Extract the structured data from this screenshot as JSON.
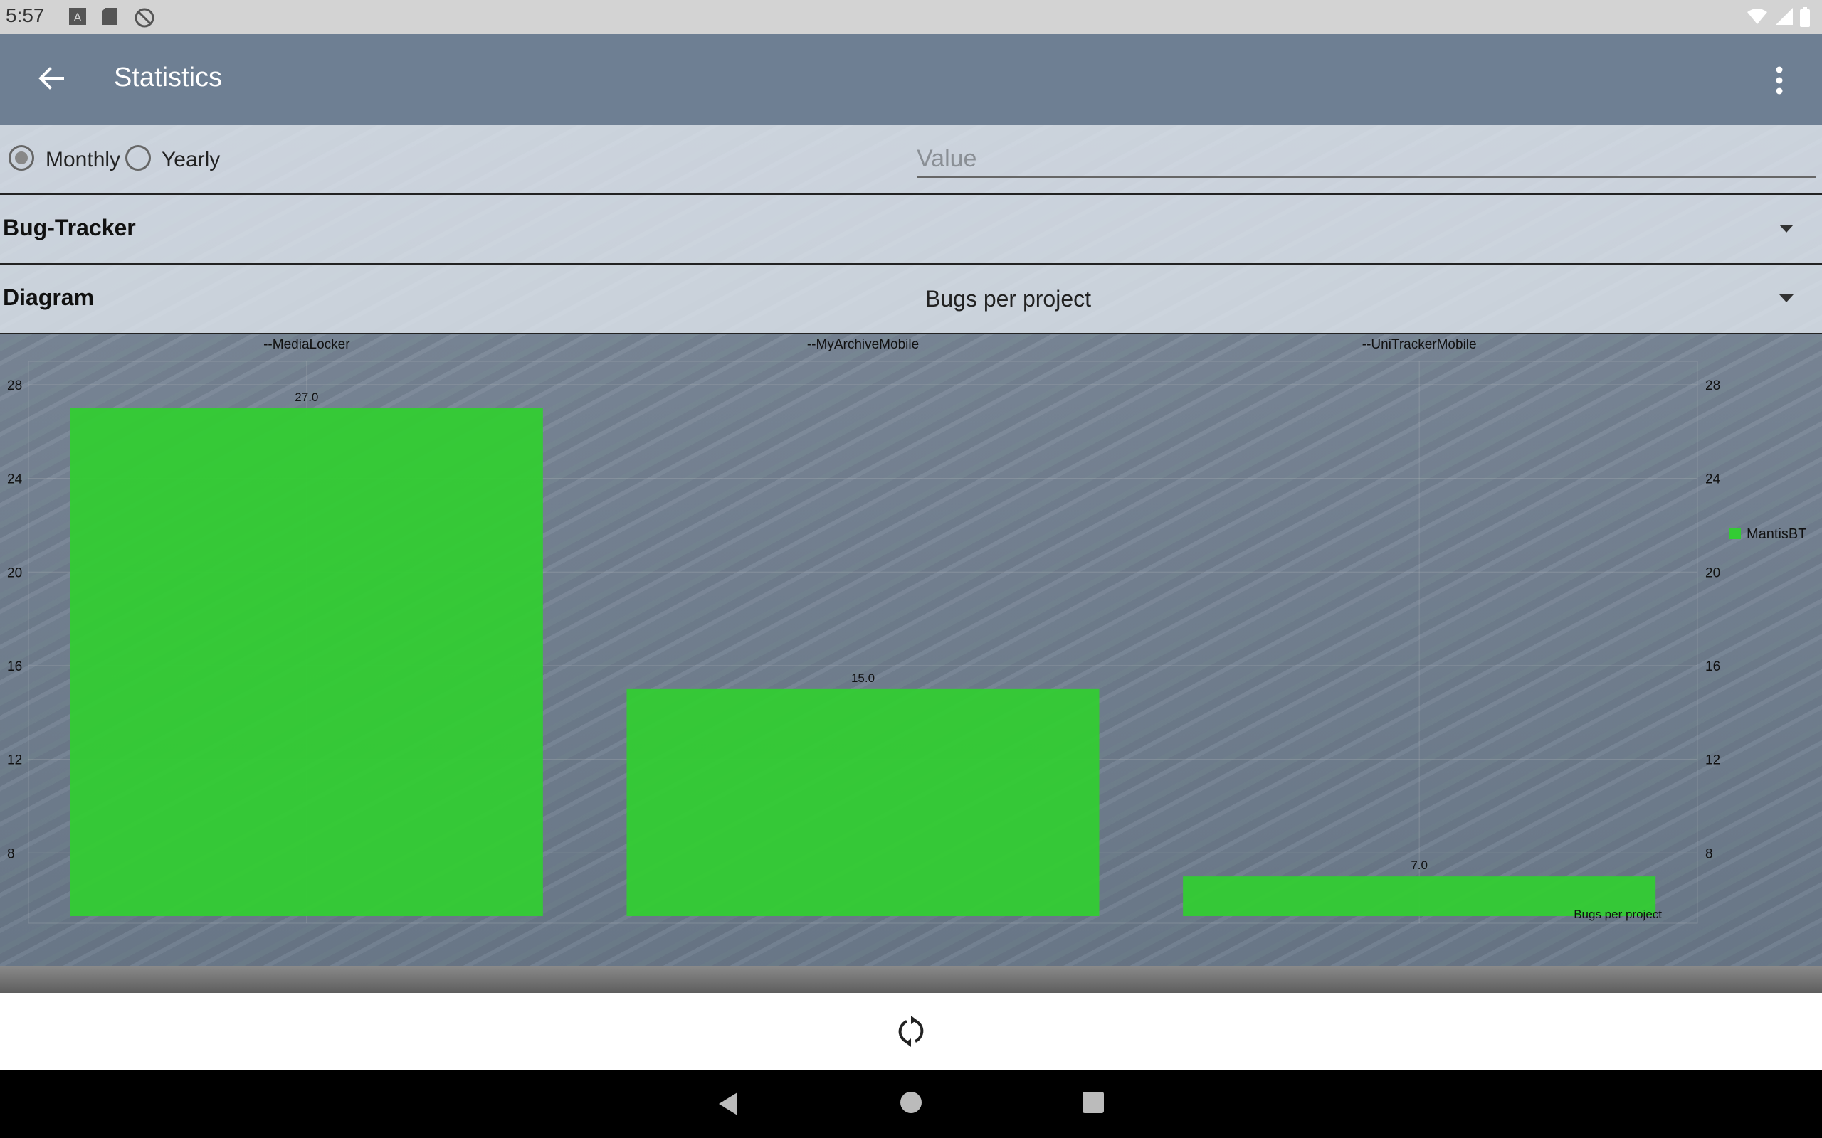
{
  "status_bar": {
    "time": "5:57",
    "icons_left": [
      "a-notification-icon",
      "sd-card-icon",
      "sync-disabled-icon"
    ],
    "icons_right": [
      "wifi-icon",
      "signal-icon",
      "battery-icon"
    ]
  },
  "toolbar": {
    "title": "Statistics",
    "back_icon": "arrow-back-icon",
    "menu_icon": "more-vert-icon"
  },
  "filters": {
    "monthly_label": "Monthly",
    "yearly_label": "Yearly",
    "selected": "Monthly",
    "value_placeholder": "Value",
    "value": ""
  },
  "bug_tracker": {
    "label": "Bug-Tracker",
    "selected": ""
  },
  "diagram": {
    "label": "Diagram",
    "selected": "Bugs per project"
  },
  "chart_data": {
    "type": "bar",
    "categories": [
      "--MediaLocker",
      "--MyArchiveMobile",
      "--UniTrackerMobile"
    ],
    "series": [
      {
        "name": "MantisBT",
        "values": [
          27.0,
          15.0,
          7.0
        ],
        "color": "#33cc33"
      }
    ],
    "value_labels": [
      "27.0",
      "15.0",
      "7.0"
    ],
    "description": "Bugs per project",
    "ylim": [
      5,
      29
    ],
    "yticks": [
      8,
      12,
      16,
      20,
      24,
      28
    ],
    "legend_position": "right",
    "grid": true
  },
  "bottom": {
    "refresh_icon": "refresh-icon"
  },
  "nav_bar": {
    "back_icon": "nav-back-icon",
    "home_icon": "nav-home-icon",
    "recents_icon": "nav-recents-icon"
  }
}
